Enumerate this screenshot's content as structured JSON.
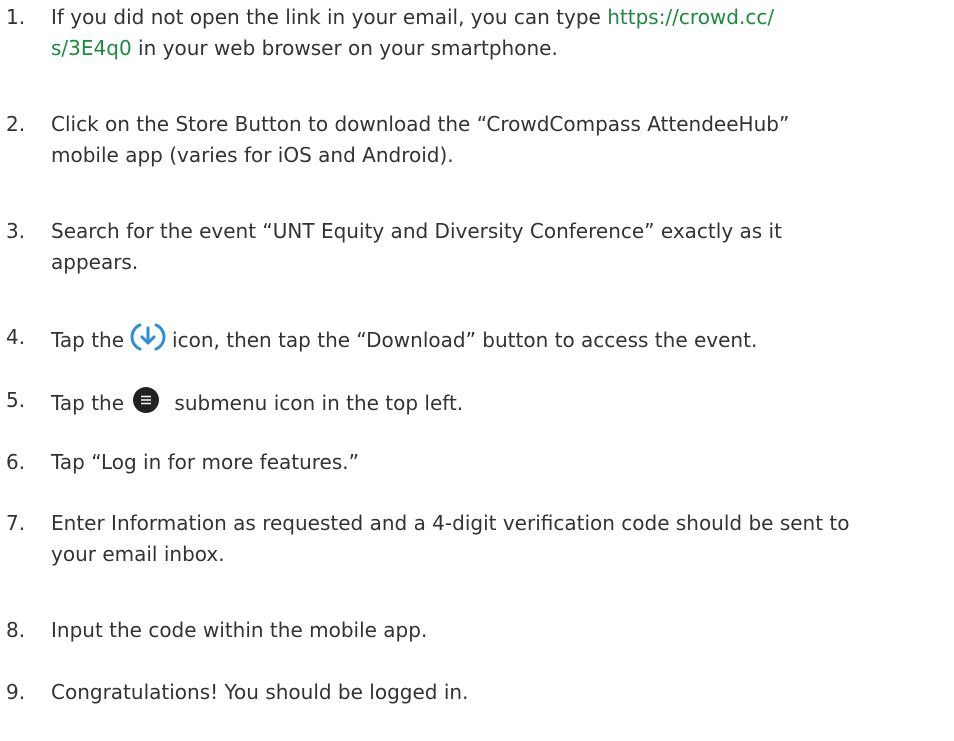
{
  "steps": [
    {
      "number": "1.",
      "text_before": "If you did not open the link in your email, you can type ",
      "link_text": "https://crowd.cc/",
      "link_text2": "s/3E4q0",
      "text_after": " in your web browser on your smartphone."
    },
    {
      "number": "2.",
      "line1": "Click on the Store Button to download the “CrowdCompass AttendeeHub”",
      "line2": "mobile app (varies for iOS and Android)."
    },
    {
      "number": "3.",
      "line1": "Search for the event “UNT Equity and Diversity Conference” exactly as it",
      "line2": "appears."
    },
    {
      "number": "4.",
      "text_before": "Tap the",
      "icon": "download-circle-icon",
      "text_after": "icon, then tap the “Download” button to access the event."
    },
    {
      "number": "5.",
      "text_before": "Tap the",
      "icon": "menu-circle-icon",
      "text_after": "submenu icon in the top left."
    },
    {
      "number": "6.",
      "text": "Tap “Log in for more features.”"
    },
    {
      "number": "7.",
      "line1": "Enter Information as requested and a 4-digit verification code should be sent to",
      "line2": "your email inbox."
    },
    {
      "number": "8.",
      "text": "Input the code within the mobile app."
    },
    {
      "number": "9.",
      "text": "Congratulations! You should be logged in."
    }
  ],
  "colors": {
    "link": "#1b8a3e",
    "download_icon": "#2a8fd6",
    "menu_icon": "#222222"
  }
}
